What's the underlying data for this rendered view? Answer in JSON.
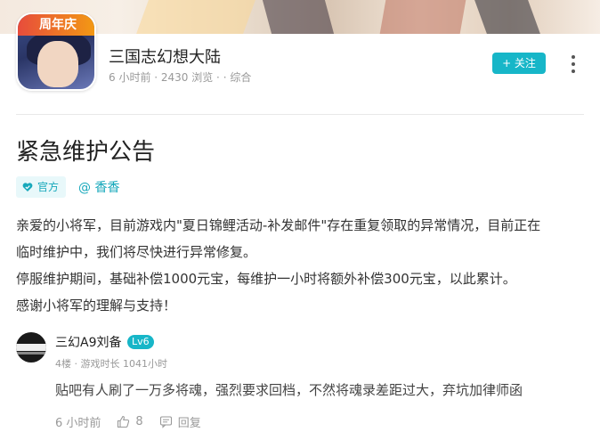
{
  "game": {
    "icon_badge": "周年庆",
    "title": "三国志幻想大陆",
    "meta": "6 小时前 · 2430 浏览 · · 综合",
    "follow_label": "+ 关注"
  },
  "post": {
    "title": "紧急维护公告",
    "official_tag": "官方",
    "author": "@ 香香",
    "paragraphs": [
      "亲爱的小将军，目前游戏内\"夏日锦鲤活动-补发邮件\"存在重复领取的异常情况，目前正在",
      "临时维护中，我们将尽快进行异常修复。",
      "停服维护期间，基础补偿1000元宝，每维护一小时将额外补偿300元宝，以此累计。",
      "感谢小将军的理解与支持！"
    ]
  },
  "comment": {
    "username": "三幻A9刘备",
    "level": "Lv6",
    "meta": "4楼 · 游戏时长 1041小时",
    "body": "贴吧有人刷了一万多将魂，强烈要求回档，不然将魂录差距过大，弃坑加律师函",
    "time": "6 小时前",
    "likes": "8",
    "reply_label": "回复"
  },
  "colors": {
    "accent": "#17b6c8",
    "text": "#333333",
    "muted": "#999999"
  }
}
